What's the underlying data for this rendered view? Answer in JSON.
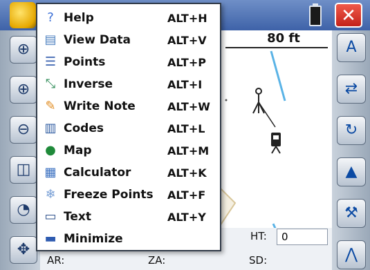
{
  "titlebar": {
    "close_label": "✕"
  },
  "map": {
    "scale_label": "80 ft"
  },
  "menu": {
    "items": [
      {
        "label": "Help",
        "shortcut": "ALT+H",
        "icon": "help-icon",
        "color": "#3b6fd6",
        "glyph": "?"
      },
      {
        "label": "View Data",
        "shortcut": "ALT+V",
        "icon": "view-data-icon",
        "color": "#4b7fbf",
        "glyph": "▤"
      },
      {
        "label": "Points",
        "shortcut": "ALT+P",
        "icon": "points-icon",
        "color": "#3a62b0",
        "glyph": "☰"
      },
      {
        "label": "Inverse",
        "shortcut": "ALT+I",
        "icon": "inverse-icon",
        "color": "#2e8b57",
        "glyph": "⤡"
      },
      {
        "label": "Write Note",
        "shortcut": "ALT+W",
        "icon": "pencil-icon",
        "color": "#e08a1e",
        "glyph": "✎"
      },
      {
        "label": "Codes",
        "shortcut": "ALT+L",
        "icon": "book-icon",
        "color": "#2c5aa0",
        "glyph": "▥"
      },
      {
        "label": "Map",
        "shortcut": "ALT+M",
        "icon": "globe-icon",
        "color": "#1f8a3a",
        "glyph": "●"
      },
      {
        "label": "Calculator",
        "shortcut": "ALT+K",
        "icon": "calculator-icon",
        "color": "#3a6fc0",
        "glyph": "▦"
      },
      {
        "label": "Freeze Points",
        "shortcut": "ALT+F",
        "icon": "freeze-icon",
        "color": "#7aa0d6",
        "glyph": "❄"
      },
      {
        "label": "Text",
        "shortcut": "ALT+Y",
        "icon": "text-icon",
        "color": "#2c4f8a",
        "glyph": "▭"
      },
      {
        "label": "Minimize",
        "shortcut": "",
        "icon": "minimize-icon",
        "color": "#2e5bb0",
        "glyph": "▬"
      }
    ]
  },
  "status": {
    "ht_label": "HT:",
    "ht_value": "0",
    "ar_label": "AR:",
    "za_label": "ZA:",
    "sd_label": "SD:"
  }
}
